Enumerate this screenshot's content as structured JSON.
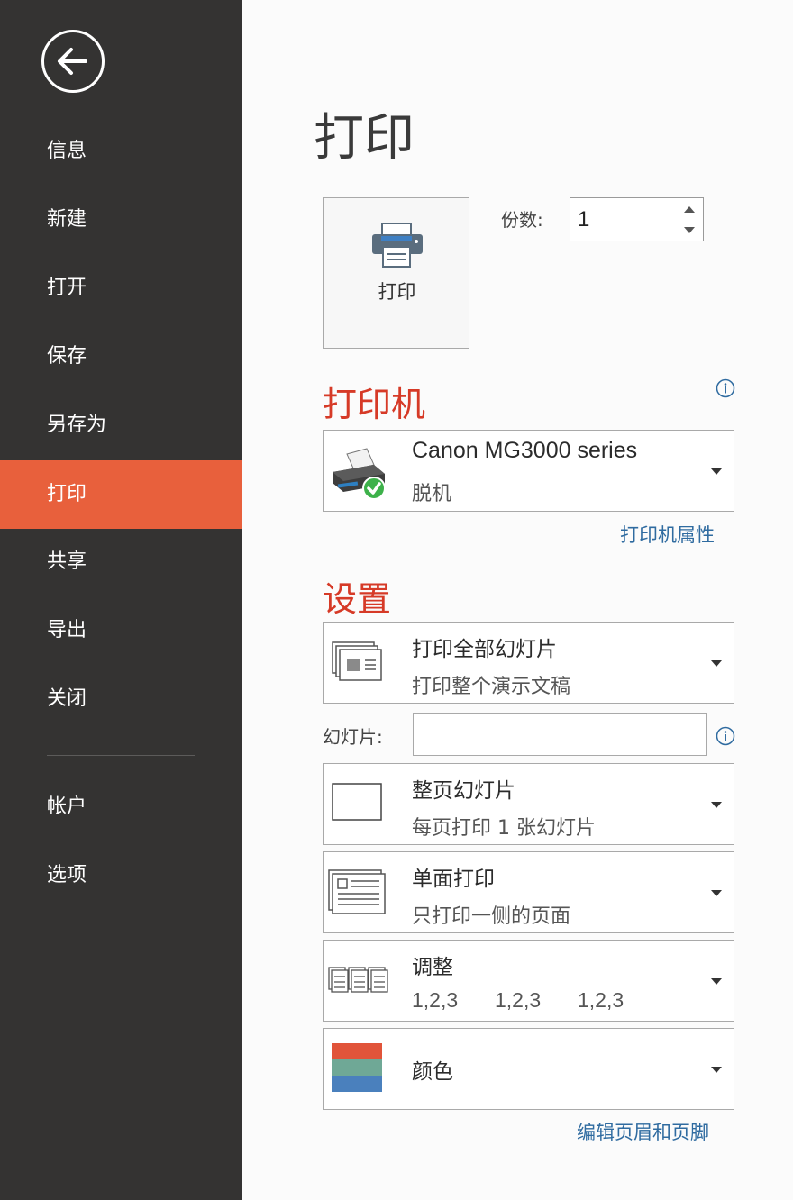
{
  "sidebar": {
    "items": [
      {
        "label": "信息"
      },
      {
        "label": "新建"
      },
      {
        "label": "打开"
      },
      {
        "label": "保存"
      },
      {
        "label": "另存为"
      },
      {
        "label": "打印",
        "active": true
      },
      {
        "label": "共享"
      },
      {
        "label": "导出"
      },
      {
        "label": "关闭"
      },
      {
        "label": "帐户"
      },
      {
        "label": "选项"
      }
    ]
  },
  "main": {
    "title": "打印",
    "print_button_label": "打印",
    "copies_label": "份数:",
    "copies_value": "1",
    "printer_section_title": "打印机",
    "printer": {
      "name": "Canon MG3000 series",
      "status": "脱机"
    },
    "printer_properties_link": "打印机属性",
    "settings_section_title": "设置",
    "settings": {
      "range": {
        "title": "打印全部幻灯片",
        "subtitle": "打印整个演示文稿"
      },
      "slides_label": "幻灯片:",
      "slides_value": "",
      "layout": {
        "title": "整页幻灯片",
        "subtitle": "每页打印 1 张幻灯片"
      },
      "sides": {
        "title": "单面打印",
        "subtitle": "只打印一侧的页面"
      },
      "collate": {
        "title": "调整",
        "sequence": [
          "1,2,3",
          "1,2,3",
          "1,2,3"
        ]
      },
      "color": {
        "title": "颜色",
        "swatch_colors": [
          "#e1543a",
          "#6fa896",
          "#4a80bd"
        ]
      }
    },
    "edit_header_footer_link": "编辑页眉和页脚"
  },
  "colors": {
    "sidebar_bg": "#343332",
    "sidebar_active": "#e8603c",
    "section_title": "#d63a27",
    "link": "#2f6ba0"
  },
  "icons": {
    "back": "back-arrow-icon",
    "print_button": "printer-icon",
    "printer_device": "printer-ready-icon",
    "info": "info-icon",
    "dropdown": "chevron-down-icon"
  }
}
